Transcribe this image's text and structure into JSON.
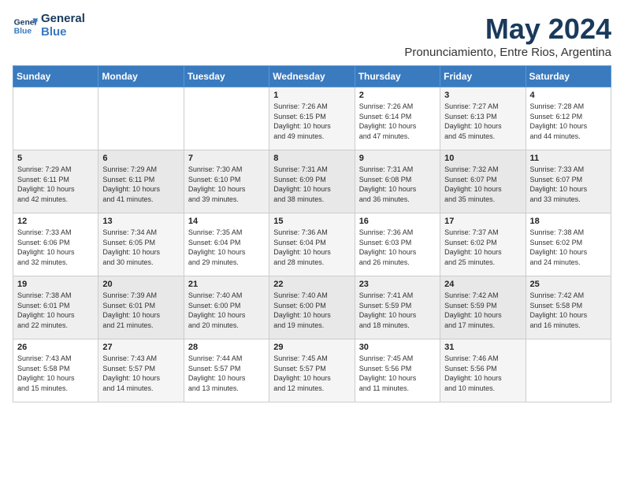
{
  "header": {
    "logo_line1": "General",
    "logo_line2": "Blue",
    "month": "May 2024",
    "location": "Pronunciamiento, Entre Rios, Argentina"
  },
  "days_of_week": [
    "Sunday",
    "Monday",
    "Tuesday",
    "Wednesday",
    "Thursday",
    "Friday",
    "Saturday"
  ],
  "weeks": [
    [
      {
        "day": "",
        "info": ""
      },
      {
        "day": "",
        "info": ""
      },
      {
        "day": "",
        "info": ""
      },
      {
        "day": "1",
        "info": "Sunrise: 7:26 AM\nSunset: 6:15 PM\nDaylight: 10 hours\nand 49 minutes."
      },
      {
        "day": "2",
        "info": "Sunrise: 7:26 AM\nSunset: 6:14 PM\nDaylight: 10 hours\nand 47 minutes."
      },
      {
        "day": "3",
        "info": "Sunrise: 7:27 AM\nSunset: 6:13 PM\nDaylight: 10 hours\nand 45 minutes."
      },
      {
        "day": "4",
        "info": "Sunrise: 7:28 AM\nSunset: 6:12 PM\nDaylight: 10 hours\nand 44 minutes."
      }
    ],
    [
      {
        "day": "5",
        "info": "Sunrise: 7:29 AM\nSunset: 6:11 PM\nDaylight: 10 hours\nand 42 minutes."
      },
      {
        "day": "6",
        "info": "Sunrise: 7:29 AM\nSunset: 6:11 PM\nDaylight: 10 hours\nand 41 minutes."
      },
      {
        "day": "7",
        "info": "Sunrise: 7:30 AM\nSunset: 6:10 PM\nDaylight: 10 hours\nand 39 minutes."
      },
      {
        "day": "8",
        "info": "Sunrise: 7:31 AM\nSunset: 6:09 PM\nDaylight: 10 hours\nand 38 minutes."
      },
      {
        "day": "9",
        "info": "Sunrise: 7:31 AM\nSunset: 6:08 PM\nDaylight: 10 hours\nand 36 minutes."
      },
      {
        "day": "10",
        "info": "Sunrise: 7:32 AM\nSunset: 6:07 PM\nDaylight: 10 hours\nand 35 minutes."
      },
      {
        "day": "11",
        "info": "Sunrise: 7:33 AM\nSunset: 6:07 PM\nDaylight: 10 hours\nand 33 minutes."
      }
    ],
    [
      {
        "day": "12",
        "info": "Sunrise: 7:33 AM\nSunset: 6:06 PM\nDaylight: 10 hours\nand 32 minutes."
      },
      {
        "day": "13",
        "info": "Sunrise: 7:34 AM\nSunset: 6:05 PM\nDaylight: 10 hours\nand 30 minutes."
      },
      {
        "day": "14",
        "info": "Sunrise: 7:35 AM\nSunset: 6:04 PM\nDaylight: 10 hours\nand 29 minutes."
      },
      {
        "day": "15",
        "info": "Sunrise: 7:36 AM\nSunset: 6:04 PM\nDaylight: 10 hours\nand 28 minutes."
      },
      {
        "day": "16",
        "info": "Sunrise: 7:36 AM\nSunset: 6:03 PM\nDaylight: 10 hours\nand 26 minutes."
      },
      {
        "day": "17",
        "info": "Sunrise: 7:37 AM\nSunset: 6:02 PM\nDaylight: 10 hours\nand 25 minutes."
      },
      {
        "day": "18",
        "info": "Sunrise: 7:38 AM\nSunset: 6:02 PM\nDaylight: 10 hours\nand 24 minutes."
      }
    ],
    [
      {
        "day": "19",
        "info": "Sunrise: 7:38 AM\nSunset: 6:01 PM\nDaylight: 10 hours\nand 22 minutes."
      },
      {
        "day": "20",
        "info": "Sunrise: 7:39 AM\nSunset: 6:01 PM\nDaylight: 10 hours\nand 21 minutes."
      },
      {
        "day": "21",
        "info": "Sunrise: 7:40 AM\nSunset: 6:00 PM\nDaylight: 10 hours\nand 20 minutes."
      },
      {
        "day": "22",
        "info": "Sunrise: 7:40 AM\nSunset: 6:00 PM\nDaylight: 10 hours\nand 19 minutes."
      },
      {
        "day": "23",
        "info": "Sunrise: 7:41 AM\nSunset: 5:59 PM\nDaylight: 10 hours\nand 18 minutes."
      },
      {
        "day": "24",
        "info": "Sunrise: 7:42 AM\nSunset: 5:59 PM\nDaylight: 10 hours\nand 17 minutes."
      },
      {
        "day": "25",
        "info": "Sunrise: 7:42 AM\nSunset: 5:58 PM\nDaylight: 10 hours\nand 16 minutes."
      }
    ],
    [
      {
        "day": "26",
        "info": "Sunrise: 7:43 AM\nSunset: 5:58 PM\nDaylight: 10 hours\nand 15 minutes."
      },
      {
        "day": "27",
        "info": "Sunrise: 7:43 AM\nSunset: 5:57 PM\nDaylight: 10 hours\nand 14 minutes."
      },
      {
        "day": "28",
        "info": "Sunrise: 7:44 AM\nSunset: 5:57 PM\nDaylight: 10 hours\nand 13 minutes."
      },
      {
        "day": "29",
        "info": "Sunrise: 7:45 AM\nSunset: 5:57 PM\nDaylight: 10 hours\nand 12 minutes."
      },
      {
        "day": "30",
        "info": "Sunrise: 7:45 AM\nSunset: 5:56 PM\nDaylight: 10 hours\nand 11 minutes."
      },
      {
        "day": "31",
        "info": "Sunrise: 7:46 AM\nSunset: 5:56 PM\nDaylight: 10 hours\nand 10 minutes."
      },
      {
        "day": "",
        "info": ""
      }
    ]
  ]
}
